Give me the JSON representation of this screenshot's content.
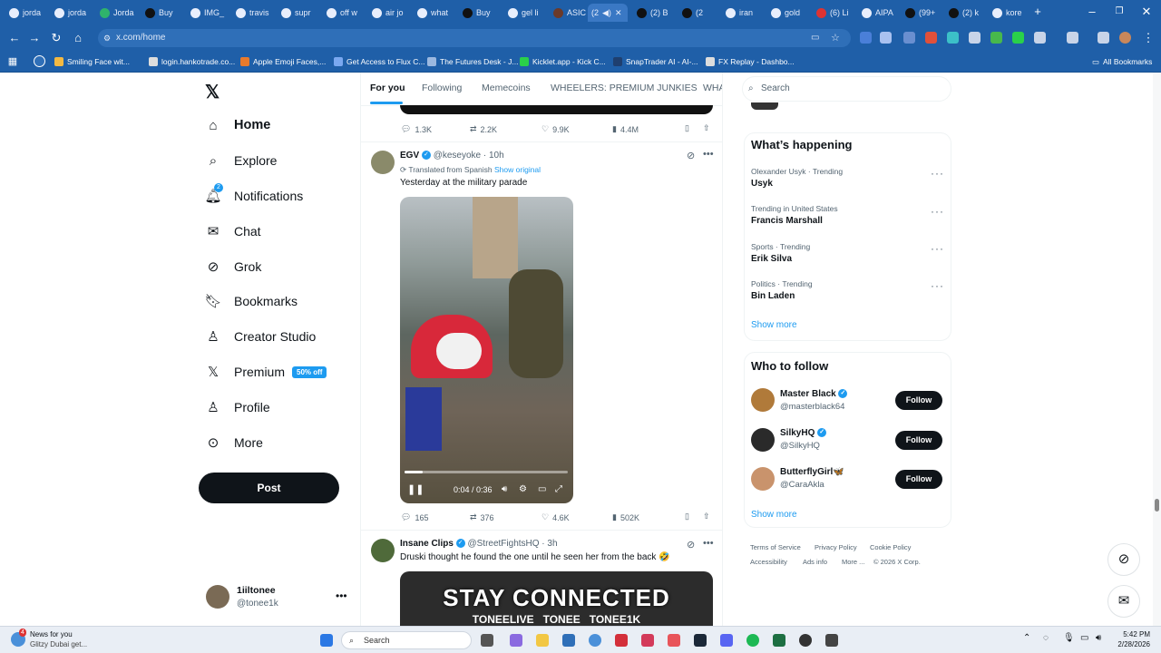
{
  "browser": {
    "tabs": [
      "jorda",
      "jorda",
      "Jorda",
      "Buy",
      "IMG_",
      "travis",
      "supr",
      "off w",
      "air jo",
      "what",
      "Buy",
      "gel li",
      "ASIC",
      "(2",
      "(2) B",
      "(2",
      "iran",
      "gold",
      "(6) Li",
      "AIPA",
      "(99+",
      "(2) k",
      "kore"
    ],
    "url": "x.com/home",
    "bookmarks": [
      "Smiling Face wit...",
      "login.hankotrade.co...",
      "Apple Emoji Faces,...",
      "Get Access to Flux C...",
      "The Futures Desk - J...",
      "Kicklet.app - Kick C...",
      "SnapTrader AI - AI-...",
      "FX Replay - Dashbo...",
      "All Bookmarks"
    ]
  },
  "nav": {
    "home": "Home",
    "explore": "Explore",
    "notifications": "Notifications",
    "notification_count": "2",
    "chat": "Chat",
    "grok": "Grok",
    "bookmarks": "Bookmarks",
    "creator_studio": "Creator Studio",
    "premium": "Premium",
    "premium_badge": "50% off",
    "profile": "Profile",
    "more": "More",
    "post": "Post",
    "account_name": "1iiltonee",
    "account_handle": "@tonee1k"
  },
  "feed": {
    "tabs": [
      "For you",
      "Following",
      "Memecoins",
      "WHEELERS: PREMIUM JUNKIES",
      "WHA"
    ],
    "prev_post_stats": {
      "replies": "1.3K",
      "reposts": "2.2K",
      "likes": "9.9K",
      "views": "4.4M"
    },
    "post1": {
      "name": "EGV",
      "handle": "@keseyoke · 10h",
      "translated": "Translated from Spanish",
      "show_original": "Show original",
      "text": "Yesterday at the military parade",
      "video_time": "0:04 / 0:36",
      "video_progress": 0.11,
      "stats": {
        "replies": "165",
        "reposts": "376",
        "likes": "4.6K",
        "views": "502K"
      }
    },
    "post2": {
      "name": "Insane Clips",
      "handle": "@StreetFightsHQ · 3h",
      "text": "Druski thought he found the one until he seen her from the back 🤣",
      "banner_title": "STAY CONNECTED",
      "banner_sub": "TONEELIVE   TONEE   TONEE1K"
    }
  },
  "right": {
    "search_placeholder": "Search",
    "whats_happening": "What’s happening",
    "trends": [
      {
        "meta": "Olexander Usyk · Trending",
        "name": "Usyk"
      },
      {
        "meta": "Trending in United States",
        "name": "Francis Marshall"
      },
      {
        "meta": "Sports · Trending",
        "name": "Erik Silva"
      },
      {
        "meta": "Politics · Trending",
        "name": "Bin Laden"
      }
    ],
    "show_more": "Show more",
    "who_to_follow": "Who to follow",
    "follow_label": "Follow",
    "suggestions": [
      {
        "name": "Master Black",
        "handle": "@masterblack64"
      },
      {
        "name": "SilkyHQ",
        "handle": "@SilkyHQ"
      },
      {
        "name": "ButterflyGirl🦋",
        "handle": "@CaraAkla"
      }
    ],
    "footer": [
      "Terms of Service",
      "Privacy Policy",
      "Cookie Policy",
      "Accessibility",
      "Ads info",
      "More ...",
      "© 2026 X Corp."
    ]
  },
  "taskbar": {
    "news_title": "News for you",
    "news_sub": "Glitzy Dubai get...",
    "news_badge": "4",
    "search": "Search",
    "time": "5:42 PM",
    "date": "2/28/2026"
  }
}
